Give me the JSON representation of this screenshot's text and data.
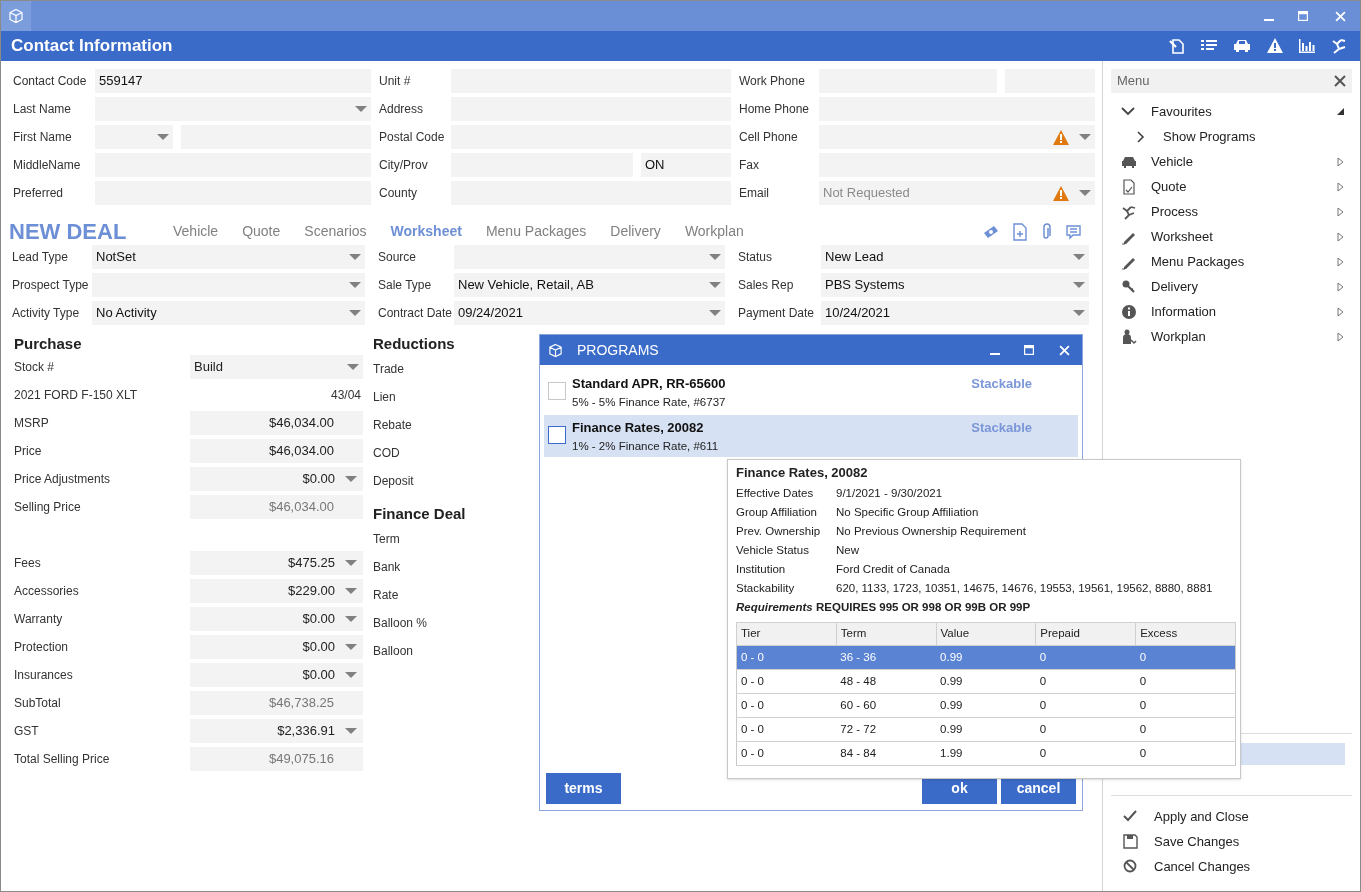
{
  "header": {
    "title": "Contact Information"
  },
  "contact": {
    "columns": [
      [
        {
          "label": "Contact Code",
          "fields": [
            {
              "kind": "text",
              "value": "559147"
            }
          ]
        },
        {
          "label": "Last Name",
          "fields": [
            {
              "kind": "dropdown"
            }
          ]
        },
        {
          "label": "First Name",
          "fields": [
            {
              "kind": "short_dropdown"
            },
            {
              "kind": "text"
            }
          ]
        },
        {
          "label": "MiddleName",
          "fields": [
            {
              "kind": "text"
            }
          ]
        },
        {
          "label": "Preferred",
          "fields": [
            {
              "kind": "text"
            }
          ]
        }
      ],
      [
        {
          "label": "Unit #",
          "fields": [
            {
              "kind": "text"
            }
          ]
        },
        {
          "label": "Address",
          "fields": [
            {
              "kind": "text"
            }
          ]
        },
        {
          "label": "Postal Code",
          "fields": [
            {
              "kind": "text"
            }
          ]
        },
        {
          "label": "City/Prov",
          "fields": [
            {
              "kind": "text"
            },
            {
              "kind": "short_text",
              "value": "ON"
            }
          ]
        },
        {
          "label": "County",
          "fields": [
            {
              "kind": "text"
            }
          ]
        }
      ],
      [
        {
          "label": "Work Phone",
          "fields": [
            {
              "kind": "text"
            },
            {
              "kind": "short_text"
            }
          ]
        },
        {
          "label": "Home Phone",
          "fields": [
            {
              "kind": "text"
            }
          ]
        },
        {
          "label": "Cell Phone",
          "fields": [
            {
              "kind": "dropdown",
              "warning": true
            }
          ]
        },
        {
          "label": "Fax",
          "fields": [
            {
              "kind": "text"
            }
          ]
        },
        {
          "label": "Email",
          "fields": [
            {
              "kind": "dropdown",
              "placeholder": "Not Requested",
              "warning": true
            }
          ]
        }
      ]
    ]
  },
  "deal": {
    "title": "NEW DEAL",
    "tabs": [
      {
        "label": "Vehicle",
        "selected": false
      },
      {
        "label": "Quote",
        "selected": false
      },
      {
        "label": "Scenarios",
        "selected": false
      },
      {
        "label": "Worksheet",
        "selected": true
      },
      {
        "label": "Menu Packages",
        "selected": false
      },
      {
        "label": "Delivery",
        "selected": false
      },
      {
        "label": "Workplan",
        "selected": false
      }
    ],
    "columns": [
      [
        {
          "label": "Lead Type",
          "value": "NotSet"
        },
        {
          "label": "Prospect Type"
        },
        {
          "label": "Activity Type",
          "value": "No Activity"
        }
      ],
      [
        {
          "label": "Source"
        },
        {
          "label": "Sale Type",
          "value": "New Vehicle, Retail, AB"
        },
        {
          "label": "Contract Date",
          "value": "09/24/2021"
        }
      ],
      [
        {
          "label": "Status",
          "value": "New Lead"
        },
        {
          "label": "Sales Rep",
          "value": "PBS Systems"
        },
        {
          "label": "Payment Date",
          "value": "10/24/2021"
        }
      ]
    ]
  },
  "purchase": {
    "title": "Purchase",
    "groups": [
      [
        {
          "label": "Stock #",
          "value": "Build",
          "kind": "select"
        },
        {
          "label": "2021 FORD F-150 XLT",
          "value": "43/04",
          "kind": "info"
        },
        {
          "label": "MSRP",
          "value": "$46,034.00",
          "kind": "amount"
        },
        {
          "label": "Price",
          "value": "$46,034.00",
          "kind": "amount"
        },
        {
          "label": "Price Adjustments",
          "value": "$0.00",
          "kind": "amount_select"
        },
        {
          "label": "Selling Price",
          "value": "$46,034.00",
          "kind": "total"
        }
      ],
      [
        {
          "label": "Fees",
          "value": "$475.25",
          "kind": "amount_select"
        },
        {
          "label": "Accessories",
          "value": "$229.00",
          "kind": "amount_select"
        },
        {
          "label": "Warranty",
          "value": "$0.00",
          "kind": "amount_select"
        },
        {
          "label": "Protection",
          "value": "$0.00",
          "kind": "amount_select"
        },
        {
          "label": "Insurances",
          "value": "$0.00",
          "kind": "amount_select"
        },
        {
          "label": "SubTotal",
          "value": "$46,738.25",
          "kind": "total"
        },
        {
          "label": "GST",
          "value": "$2,336.91",
          "kind": "amount_select"
        },
        {
          "label": "Total Selling Price",
          "value": "$49,075.16",
          "kind": "total"
        }
      ]
    ]
  },
  "reductions": {
    "sections": [
      {
        "title": "Reductions",
        "items": [
          "Trade",
          "Lien",
          "Rebate",
          "COD",
          "Deposit"
        ]
      },
      {
        "title": "Finance Deal",
        "items": [
          "Term",
          "Bank",
          "Rate",
          "Balloon %",
          "Balloon"
        ]
      }
    ]
  },
  "programs_dialog": {
    "title": "PROGRAMS",
    "programs": [
      {
        "name": "Standard APR, RR-65600",
        "detail": "5% - 5% Finance Rate, #6737",
        "tag": "Stackable",
        "selected": false
      },
      {
        "name": "Finance Rates, 20082",
        "detail": "1% - 2% Finance Rate, #611",
        "tag": "Stackable",
        "selected": true
      }
    ],
    "left_buttons": [
      "terms"
    ],
    "right_buttons": [
      "ok",
      "cancel"
    ]
  },
  "tooltip": {
    "title": "Finance Rates, 20082",
    "details": [
      {
        "label": "Effective Dates",
        "value": "9/1/2021 - 9/30/2021"
      },
      {
        "label": "Group Affiliation",
        "value": "No Specific Group Affiliation"
      },
      {
        "label": "Prev. Ownership",
        "value": "No Previous Ownership Requirement"
      },
      {
        "label": "Vehicle Status",
        "value": "New"
      },
      {
        "label": "Institution",
        "value": "Ford Credit of Canada"
      },
      {
        "label": "Stackability",
        "value": "620, 1133, 1723, 10351, 14675, 14676, 19553, 19561, 19562, 8880, 8881"
      }
    ],
    "requirements": {
      "label": "Requirements",
      "value": "REQUIRES 995 OR 998 OR 99B OR 99P"
    },
    "table": {
      "columns": [
        "Tier",
        "Term",
        "Value",
        "Prepaid",
        "Excess"
      ],
      "rows": [
        {
          "cells": [
            "0 - 0",
            "36 - 36",
            "0.99",
            "0",
            "0"
          ],
          "selected": true
        },
        {
          "cells": [
            "0 - 0",
            "48 - 48",
            "0.99",
            "0",
            "0"
          ],
          "selected": false
        },
        {
          "cells": [
            "0 - 0",
            "60 - 60",
            "0.99",
            "0",
            "0"
          ],
          "selected": false
        },
        {
          "cells": [
            "0 - 0",
            "72 - 72",
            "0.99",
            "0",
            "0"
          ],
          "selected": false
        },
        {
          "cells": [
            "0 - 0",
            "84 - 84",
            "1.99",
            "0",
            "0"
          ],
          "selected": false
        }
      ]
    }
  },
  "menu": {
    "title": "Menu",
    "items": [
      {
        "label": "Favourites",
        "expanded": true,
        "children": [
          {
            "label": "Show Programs"
          }
        ]
      },
      {
        "label": "Vehicle"
      },
      {
        "label": "Quote"
      },
      {
        "label": "Process"
      },
      {
        "label": "Worksheet"
      },
      {
        "label": "Menu Packages"
      },
      {
        "label": "Delivery"
      },
      {
        "label": "Information"
      },
      {
        "label": "Workplan"
      }
    ],
    "covered_row": {
      "selected": true
    },
    "actions": [
      "Apply and Close",
      "Save Changes",
      "Cancel Changes"
    ]
  }
}
